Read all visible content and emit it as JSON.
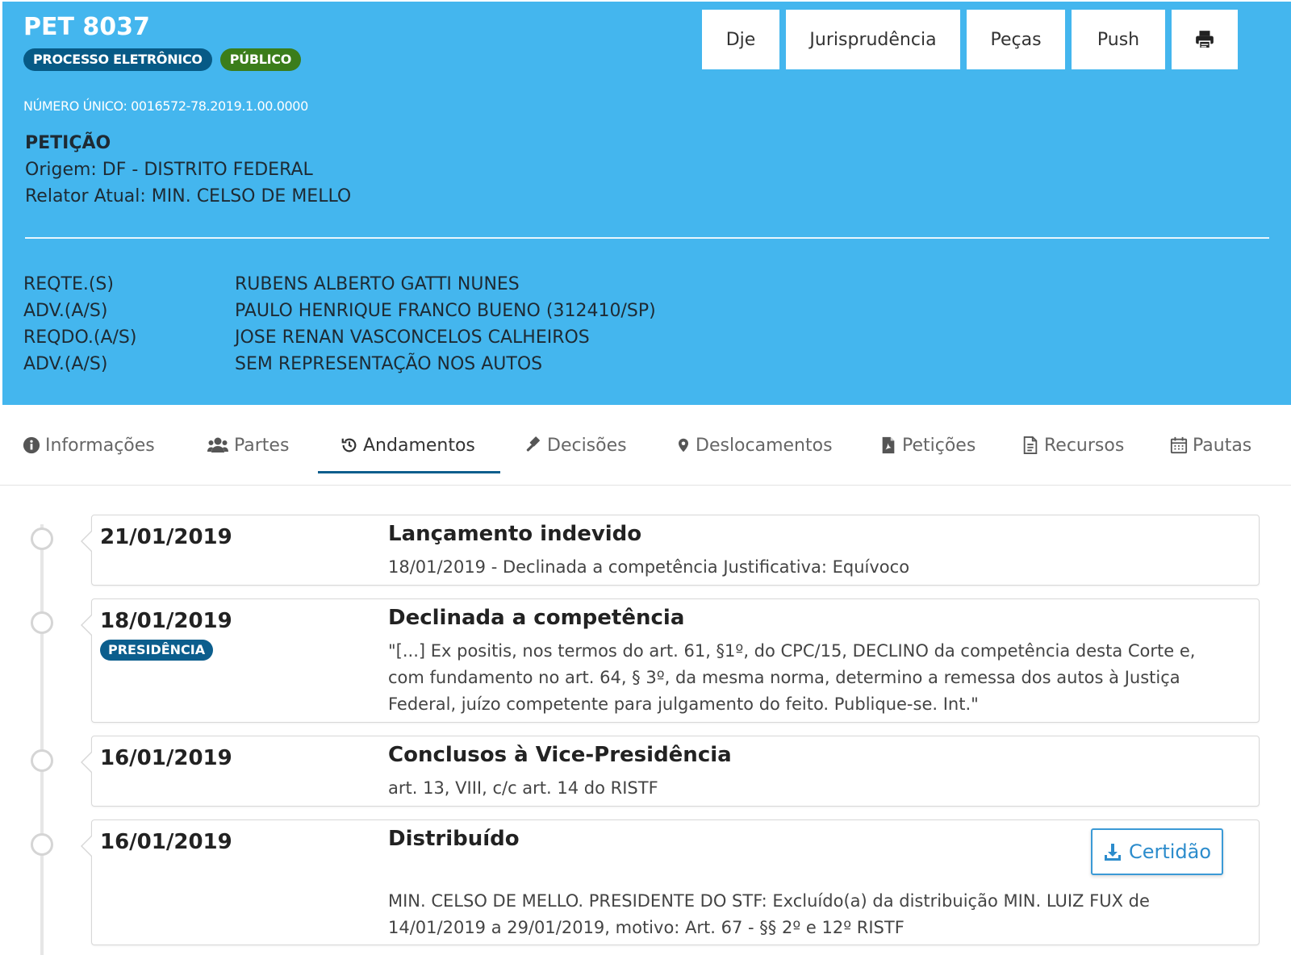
{
  "header": {
    "case_title": "PET 8037",
    "badges": {
      "eletronico": "PROCESSO ELETRÔNICO",
      "publico": "PÚBLICO"
    },
    "numero_unico": "NÚMERO ÚNICO: 0016572-78.2019.1.00.0000",
    "classe": "PETIÇÃO",
    "origem": "Origem: DF - DISTRITO FEDERAL",
    "relator": "Relator Atual: MIN. CELSO DE MELLO",
    "background_color": "#44b6ee"
  },
  "toolbar": {
    "dje": "Dje",
    "jurisprudencia": "Jurisprudência",
    "pecas": "Peças",
    "push": "Push",
    "print_icon": "print-icon"
  },
  "parties": [
    {
      "role": "REQTE.(S)",
      "name": "RUBENS ALBERTO GATTI NUNES"
    },
    {
      "role": "ADV.(A/S)",
      "name": "PAULO HENRIQUE FRANCO BUENO (312410/SP)"
    },
    {
      "role": "REQDO.(A/S)",
      "name": "JOSE RENAN VASCONCELOS CALHEIROS"
    },
    {
      "role": "ADV.(A/S)",
      "name": "SEM REPRESENTAÇÃO NOS AUTOS"
    }
  ],
  "tabs": [
    {
      "label": "Informações",
      "icon": "info-icon"
    },
    {
      "label": "Partes",
      "icon": "users-icon"
    },
    {
      "label": "Andamentos",
      "icon": "history-icon",
      "active": true
    },
    {
      "label": "Decisões",
      "icon": "gavel-icon"
    },
    {
      "label": "Deslocamentos",
      "icon": "map-marker-icon"
    },
    {
      "label": "Petições",
      "icon": "file-pdf-icon"
    },
    {
      "label": "Recursos",
      "icon": "file-text-icon"
    },
    {
      "label": "Pautas",
      "icon": "calendar-icon"
    }
  ],
  "andamentos": [
    {
      "date": "21/01/2019",
      "title": "Lançamento indevido",
      "description": "18/01/2019 - Declinada a competência Justificativa: Equívoco"
    },
    {
      "date": "18/01/2019",
      "badge": "PRESIDÊNCIA",
      "title": "Declinada a competência",
      "description": "\"[...] Ex positis, nos termos do art. 61, §1º, do CPC/15, DECLINO da competência desta Corte e, com fundamento no art. 64, § 3º, da mesma norma, determino a remessa dos autos à Justiça Federal, juízo competente para julgamento do feito. Publique-se. Int.\""
    },
    {
      "date": "16/01/2019",
      "title": "Conclusos à Vice-Presidência",
      "description": "art. 13, VIII, c/c art. 14 do RISTF"
    },
    {
      "date": "16/01/2019",
      "title": "Distribuído",
      "button": "Certidão",
      "description": "MIN. CELSO DE MELLO. PRESIDENTE DO STF: Excluído(a) da distribuição MIN. LUIZ FUX de 14/01/2019 a 29/01/2019, motivo: Art. 67 - §§ 2º e 12º RISTF"
    }
  ]
}
